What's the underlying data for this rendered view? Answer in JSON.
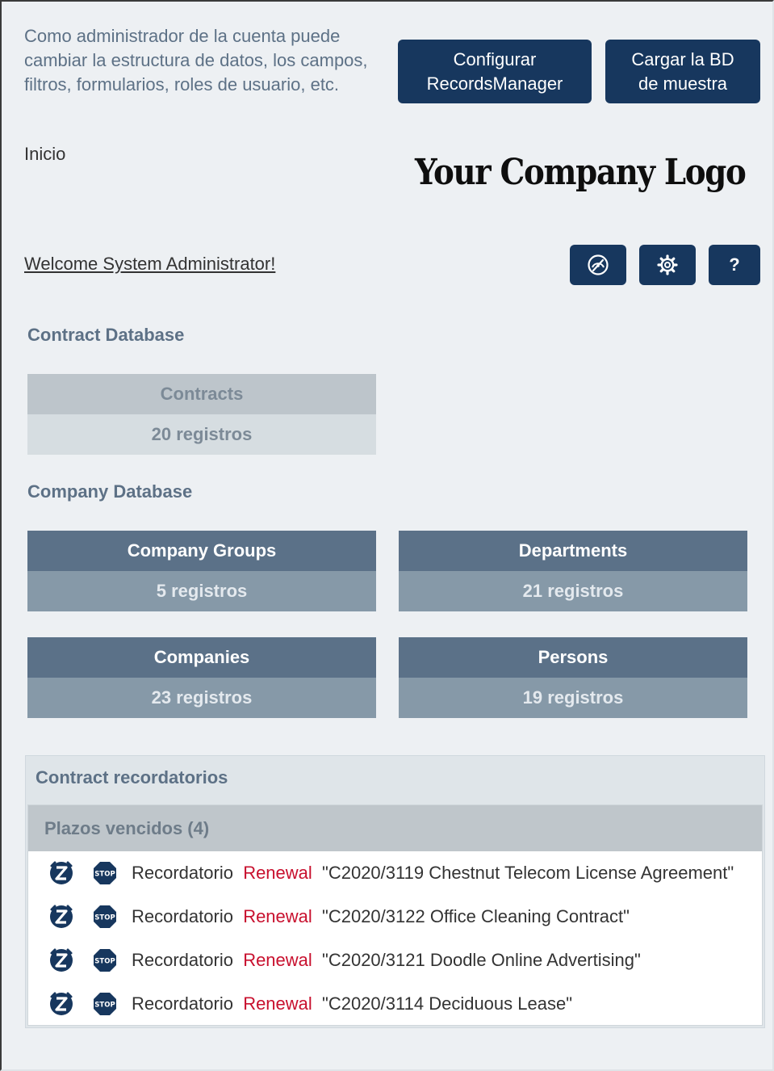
{
  "header": {
    "intro_text": "Como administrador de la cuenta puede cambiar la estructura de datos, los campos, filtros, formularios, roles de usuario, etc.",
    "configure_button_line1": "Configurar",
    "configure_button_line2": "RecordsManager",
    "load_sample_button_line1": "Cargar la BD",
    "load_sample_button_line2": "de muestra",
    "breadcrumb": "Inicio",
    "logo_text": "Your Company Logo",
    "welcome_link": "Welcome System Administrator!",
    "help_button": "?"
  },
  "icons": {
    "dashboard": "speedometer-icon",
    "settings": "gear-icon",
    "snooze": "snooze-z-icon",
    "stop": "stop-icon"
  },
  "colors": {
    "accent": "#17375e",
    "background": "#edf0f3",
    "title_text": "#5d7186",
    "tile_dark": "#5b7188",
    "tile_light": "#bdc5cb",
    "reminder_highlight": "#c8102e"
  },
  "sections": {
    "contract": {
      "title": "Contract Database",
      "tiles": [
        {
          "name": "Contracts",
          "count": "20 registros"
        }
      ]
    },
    "company": {
      "title": "Company Database",
      "tiles": [
        {
          "name": "Company Groups",
          "count": "5 registros"
        },
        {
          "name": "Departments",
          "count": "21 registros"
        },
        {
          "name": "Companies",
          "count": "23 registros"
        },
        {
          "name": "Persons",
          "count": "19 registros"
        }
      ]
    }
  },
  "reminders": {
    "title": "Contract recordatorios",
    "group_title": "Plazos vencidos (4)",
    "items": [
      {
        "prefix": "Recordatorio",
        "type": "Renewal",
        "subject": "\"C2020/3119 Chestnut Telecom License Agreement\""
      },
      {
        "prefix": "Recordatorio",
        "type": "Renewal",
        "subject": "\"C2020/3122 Office Cleaning Contract\""
      },
      {
        "prefix": "Recordatorio",
        "type": "Renewal",
        "subject": "\"C2020/3121 Doodle Online Advertising\""
      },
      {
        "prefix": "Recordatorio",
        "type": "Renewal",
        "subject": "\"C2020/3114 Deciduous Lease\""
      }
    ]
  }
}
